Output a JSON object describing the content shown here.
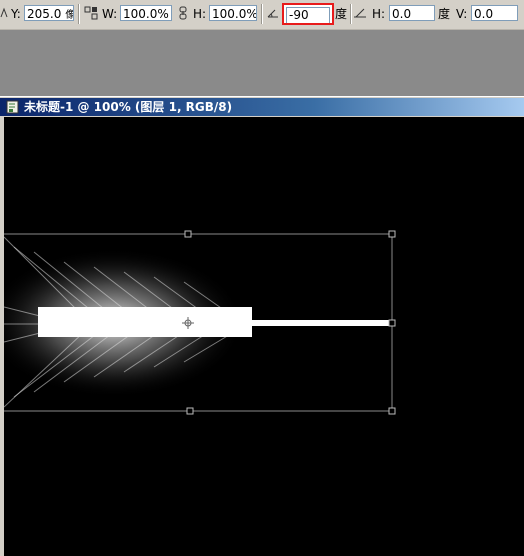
{
  "options_bar": {
    "y_label": "Y:",
    "y_value": "205.0",
    "y_unit": "像",
    "w_label": "W:",
    "w_value": "100.0%",
    "h_label": "H:",
    "h_value": "100.0%",
    "rotate_value": "-90",
    "rotate_unit": "度",
    "skew_h_label": "H:",
    "skew_h_value": "0.0",
    "skew_h_unit": "度",
    "skew_v_label": "V:",
    "skew_v_value": "0.0"
  },
  "document": {
    "title": "未标题-1 @ 100% (图层 1, RGB/8)"
  },
  "colors": {
    "highlight_border": "#e81b1b",
    "canvas_bg": "#000000",
    "title_active": "#0a246a"
  }
}
